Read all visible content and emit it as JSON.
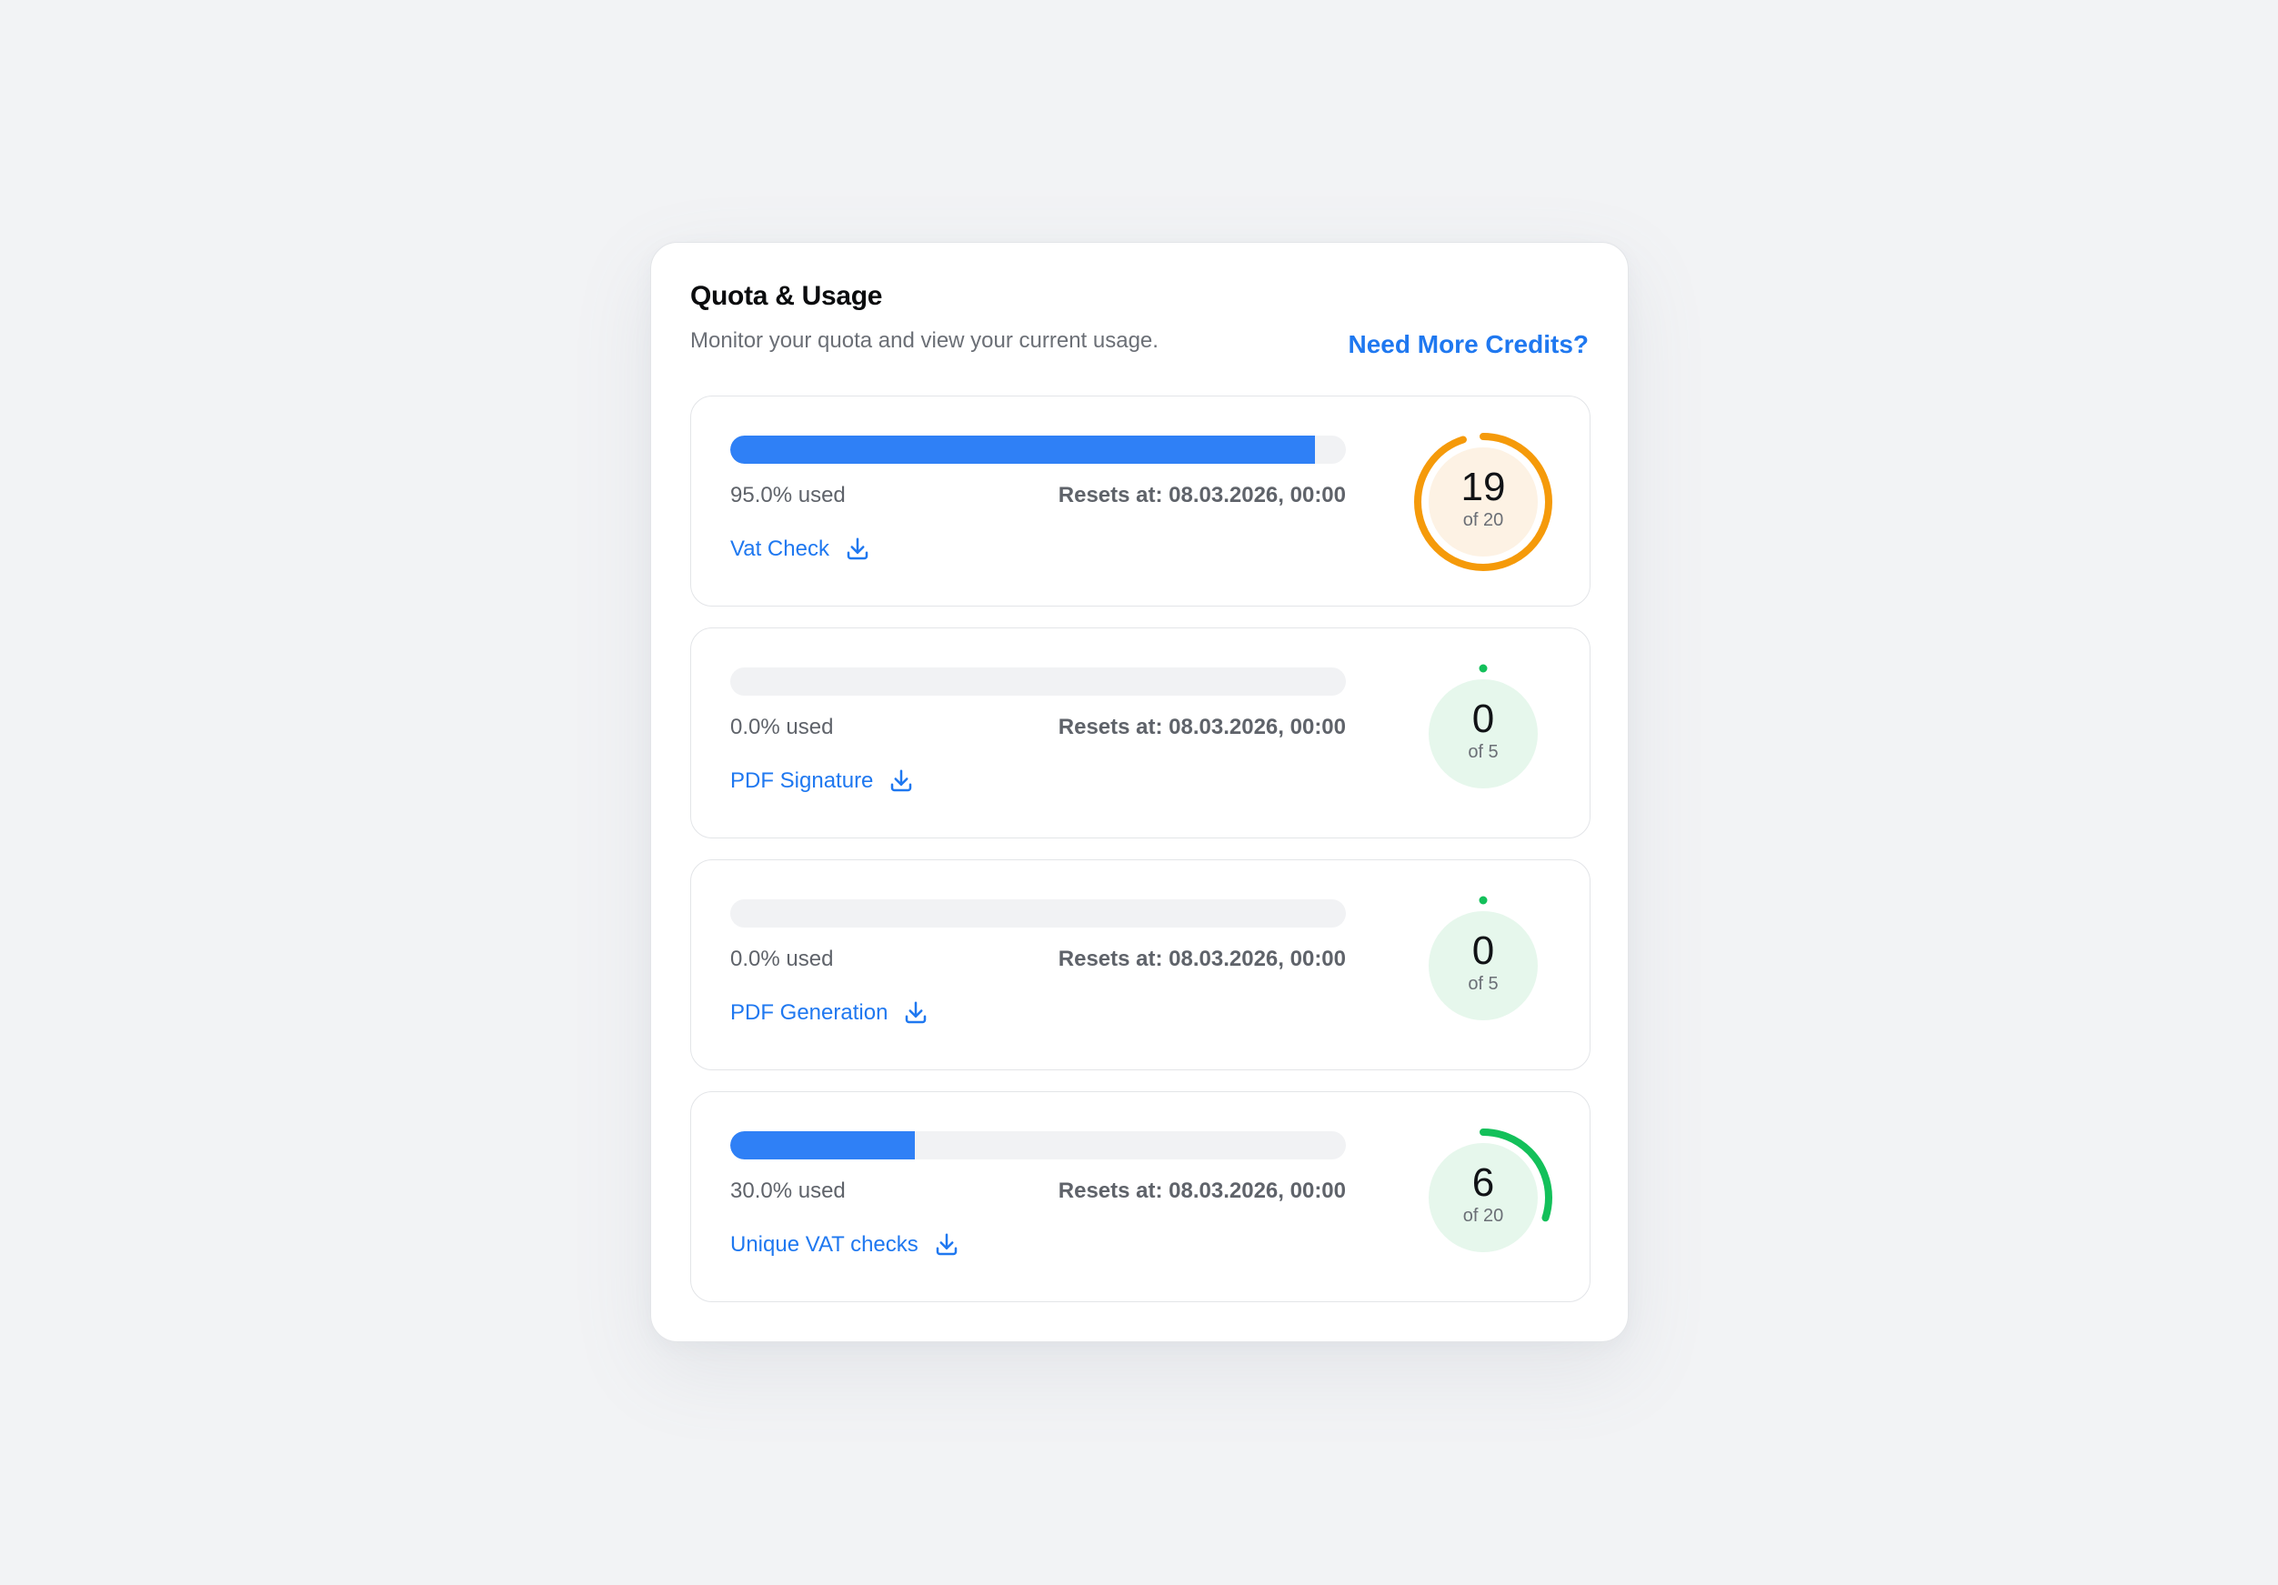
{
  "header": {
    "title": "Quota & Usage",
    "subtitle": "Monitor your quota and view your current usage.",
    "more_credits_label": "Need More Credits?"
  },
  "colors": {
    "accent": "#1f78f0",
    "bar_fill": "#2f80f6",
    "warning_ring": "#f59a0a",
    "warning_bg": "#fdf2e4",
    "ok_ring": "#13c05a",
    "ok_bg": "#e6f7ec"
  },
  "quotas": [
    {
      "name": "Vat Check",
      "used_label": "95.0% used",
      "used_fraction": 0.95,
      "resets_label": "Resets at: 08.03.2026, 00:00",
      "count": "19",
      "of_label": "of 20",
      "count_value": 19,
      "limit_value": 20,
      "status": "warning",
      "icon": "download-icon"
    },
    {
      "name": "PDF Signature",
      "used_label": "0.0% used",
      "used_fraction": 0.0,
      "resets_label": "Resets at: 08.03.2026, 00:00",
      "count": "0",
      "of_label": "of 5",
      "count_value": 0,
      "limit_value": 5,
      "status": "ok",
      "icon": "download-icon"
    },
    {
      "name": "PDF Generation",
      "used_label": "0.0% used",
      "used_fraction": 0.0,
      "resets_label": "Resets at: 08.03.2026, 00:00",
      "count": "0",
      "of_label": "of 5",
      "count_value": 0,
      "limit_value": 5,
      "status": "ok",
      "icon": "download-icon"
    },
    {
      "name": "Unique VAT checks",
      "used_label": "30.0% used",
      "used_fraction": 0.3,
      "resets_label": "Resets at: 08.03.2026, 00:00",
      "count": "6",
      "of_label": "of 20",
      "count_value": 6,
      "limit_value": 20,
      "status": "ok",
      "icon": "download-icon"
    }
  ]
}
